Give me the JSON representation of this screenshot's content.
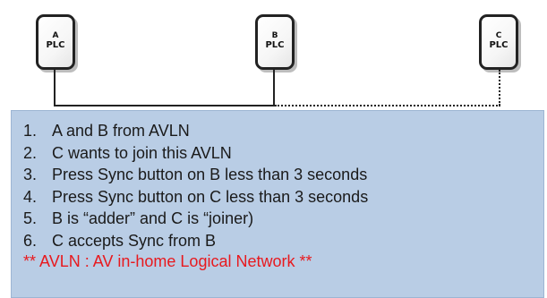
{
  "devices": [
    {
      "id": "A",
      "kind": "PLC"
    },
    {
      "id": "B",
      "kind": "PLC"
    },
    {
      "id": "C",
      "kind": "PLC"
    }
  ],
  "steps": [
    {
      "num": "1.",
      "text": "A and B from AVLN"
    },
    {
      "num": "2.",
      "text": "C wants to join this AVLN"
    },
    {
      "num": "3.",
      "text": "Press Sync button  on B less than 3 seconds"
    },
    {
      "num": "4.",
      "text": "Press Sync button  on C less than 3 seconds"
    },
    {
      "num": "5.",
      "text": "B is “adder” and C is “joiner)"
    },
    {
      "num": "6.",
      "text": "C accepts Sync from B"
    }
  ],
  "note": "** AVLN : AV in-home Logical Network **",
  "colors": {
    "panel": "#b9cde5",
    "note": "#e8191e",
    "line": "#222222"
  }
}
